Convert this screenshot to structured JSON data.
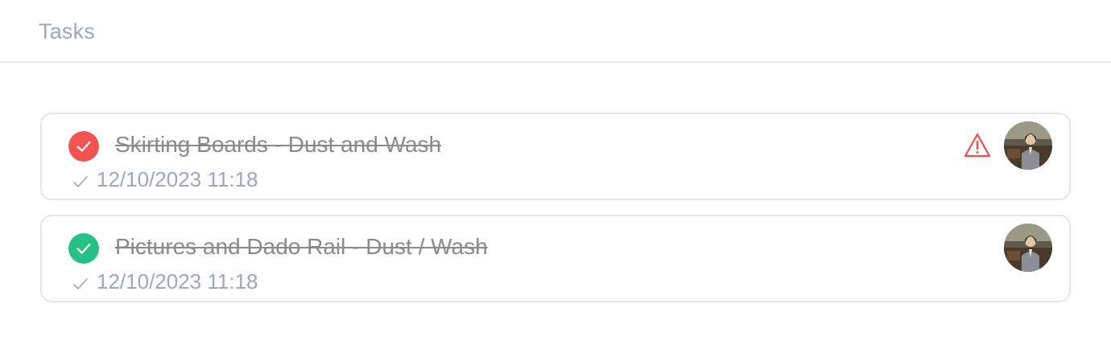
{
  "header": {
    "title": "Tasks"
  },
  "tasks": [
    {
      "title": "Skirting Boards - Dust and Wash",
      "completed_at": "12/10/2023 11:18",
      "status_color": "#f25454",
      "status_icon": "check-icon",
      "has_warning": true,
      "warning_color": "#ef4e4e",
      "warning_icon": "warning-triangle-icon",
      "avatar_icon": "user-avatar"
    },
    {
      "title": "Pictures and Dado Rail - Dust / Wash",
      "completed_at": "12/10/2023 11:18",
      "status_color": "#27c087",
      "status_icon": "check-icon",
      "has_warning": false,
      "avatar_icon": "user-avatar"
    }
  ],
  "colors": {
    "header_text": "#9aa6c8",
    "meta_text": "#9aa6c8",
    "title_text": "#8a8a8a",
    "card_border": "#e4e6ee"
  }
}
